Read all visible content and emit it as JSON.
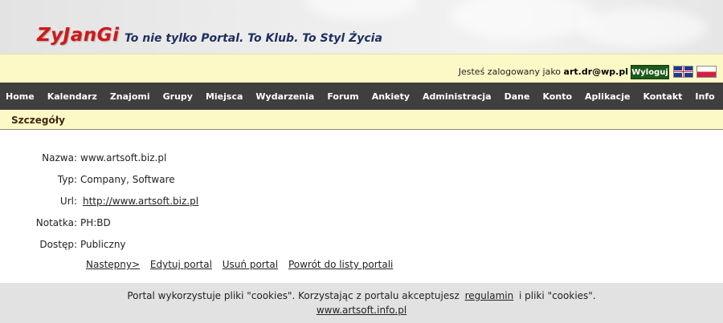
{
  "header": {
    "logo": "ZyJanGi",
    "slogan": "To nie tylko Portal. To Klub. To Styl Życia"
  },
  "userbar": {
    "logged_prefix": "Jesteś zalogowany jako",
    "username": "art.dr@wp.pl",
    "logout_label": "Wyloguj",
    "flags": [
      "english-flag-icon",
      "polish-flag-icon"
    ]
  },
  "nav": {
    "items": [
      "Home",
      "Kalendarz",
      "Znajomi",
      "Grupy",
      "Miejsca",
      "Wydarzenia",
      "Forum",
      "Ankiety",
      "Administracja",
      "Dane",
      "Konto",
      "Aplikacje",
      "Kontakt",
      "Info"
    ]
  },
  "section": {
    "title": "Szczegóły"
  },
  "details": {
    "name_label": "Nazwa:",
    "name_value": "www.artsoft.biz.pl",
    "type_label": "Typ:",
    "type_value": "Company, Software",
    "url_label": "Url:",
    "url_value": "http://www.artsoft.biz.pl",
    "note_label": "Notatka:",
    "note_value": "PH:BD",
    "access_label": "Dostęp:",
    "access_value": "Publiczny"
  },
  "actions": {
    "next": "Następny>",
    "edit": "Edytuj portal",
    "delete": "Usuń portal",
    "back": "Powrót do listy portali"
  },
  "footer": {
    "cookies_text_1": "Portal wykorzystuje pliki \"cookies\". Korzystając z portalu akceptujesz",
    "terms_link": "regulamin",
    "cookies_text_2": "i pliki \"cookies\".",
    "site_link": "www.artsoft.info.pl"
  },
  "colors": {
    "logo": "#d01818",
    "slogan": "#1f2f5e",
    "userbar_bg": "#fdf9c6",
    "nav_bg": "#3f3f3f",
    "logout_bg": "#1e5a1a",
    "footer_bg": "#e2e2e2"
  }
}
